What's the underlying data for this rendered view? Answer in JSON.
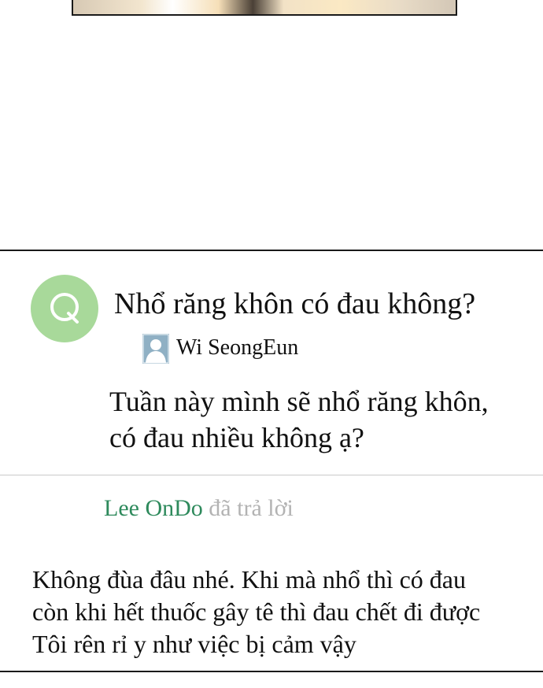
{
  "colors": {
    "badge": "#a8d99a",
    "answerer_name": "#2e8a5c",
    "answered_label": "#b3b3b3",
    "rule": "#1a1a1a",
    "divider": "#c9c9c9"
  },
  "icons": {
    "badge_letter_icon": "q-letter-icon",
    "author_icon": "user-avatar-icon"
  },
  "question": {
    "title": "Nhổ răng khôn có đau không?",
    "author": "Wi SeongEun",
    "body_lines": [
      "Tuần này mình sẽ nhổ răng khôn,",
      "có đau nhiều không ạ?"
    ]
  },
  "answer": {
    "answerer": "Lee OnDo",
    "answered_label": "đã trả lời",
    "body_lines": [
      "Không đùa đâu nhé. Khi mà nhổ thì có đau",
      "còn khi hết thuốc gây tê thì đau chết đi được",
      "Tôi rên rỉ y như việc bị cảm vậy"
    ]
  }
}
